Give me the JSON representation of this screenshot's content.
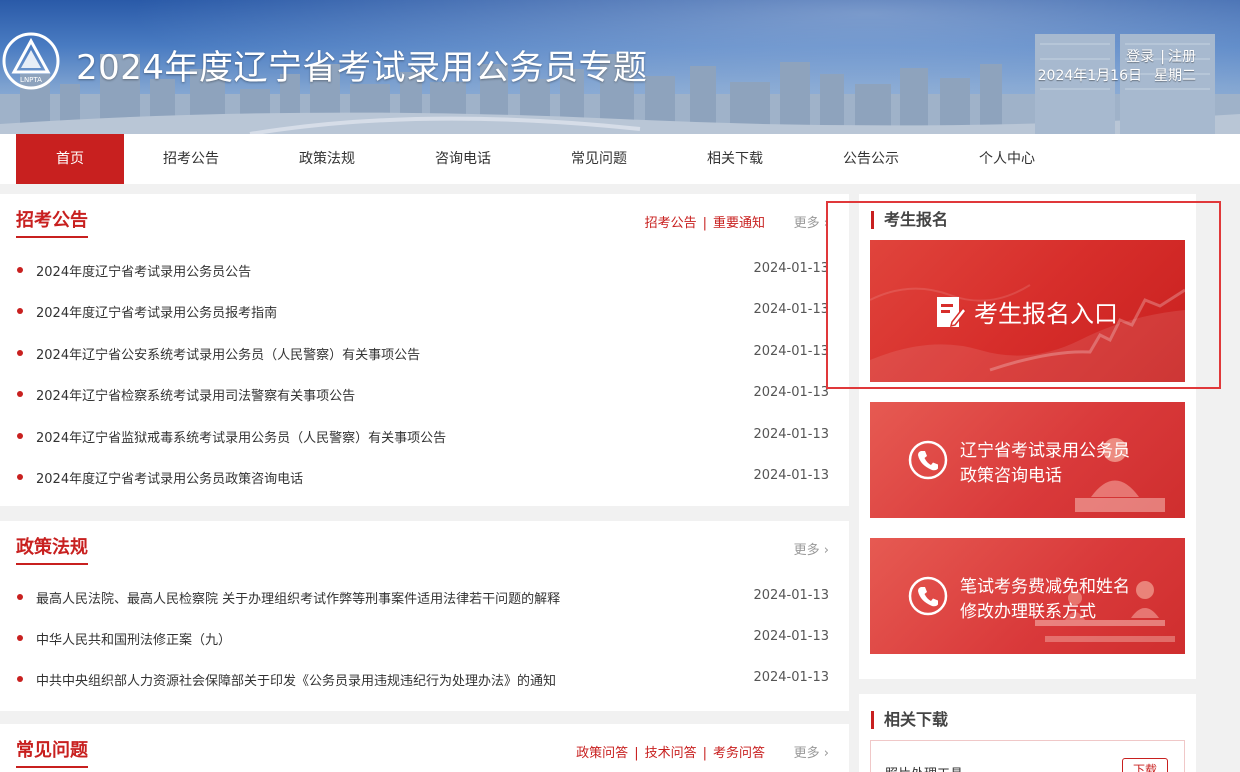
{
  "header": {
    "title": "2024年度辽宁省考试录用公务员专题",
    "logo_text": "LNPTA",
    "login": "登录",
    "register": "注册",
    "date": "2024年1月16日",
    "weekday": "星期二"
  },
  "nav": {
    "items": [
      {
        "label": "首页"
      },
      {
        "label": "招考公告"
      },
      {
        "label": "政策法规"
      },
      {
        "label": "咨询电话"
      },
      {
        "label": "常见问题"
      },
      {
        "label": "相关下载"
      },
      {
        "label": "公告公示"
      },
      {
        "label": "个人中心"
      }
    ]
  },
  "announcements": {
    "title": "招考公告",
    "links": [
      "招考公告",
      "重要通知"
    ],
    "more": "更多 ›",
    "items": [
      {
        "title": "2024年度辽宁省考试录用公务员公告",
        "date": "2024-01-13"
      },
      {
        "title": "2024年度辽宁省考试录用公务员报考指南",
        "date": "2024-01-13"
      },
      {
        "title": "2024年辽宁省公安系统考试录用公务员（人民警察）有关事项公告",
        "date": "2024-01-13"
      },
      {
        "title": "2024年辽宁省检察系统考试录用司法警察有关事项公告",
        "date": "2024-01-13"
      },
      {
        "title": "2024年辽宁省监狱戒毒系统考试录用公务员（人民警察）有关事项公告",
        "date": "2024-01-13"
      },
      {
        "title": "2024年度辽宁省考试录用公务员政策咨询电话",
        "date": "2024-01-13"
      }
    ]
  },
  "policies": {
    "title": "政策法规",
    "more": "更多 ›",
    "items": [
      {
        "title": "最高人民法院、最高人民检察院 关于办理组织考试作弊等刑事案件适用法律若干问题的解释",
        "date": "2024-01-13"
      },
      {
        "title": "中华人民共和国刑法修正案（九）",
        "date": "2024-01-13"
      },
      {
        "title": "中共中央组织部人力资源社会保障部关于印发《公务员录用违规违纪行为处理办法》的通知",
        "date": "2024-01-13"
      }
    ]
  },
  "faq": {
    "title": "常见问题",
    "links": [
      "政策问答",
      "技术问答",
      "考务问答"
    ],
    "more": "更多 ›"
  },
  "registration": {
    "title": "考生报名",
    "entry": "考生报名入口",
    "hotline_line1": "辽宁省考试录用公务员",
    "hotline_line2": "政策咨询电话",
    "fee_line1": "笔试考务费减免和姓名",
    "fee_line2": "修改办理联系方式"
  },
  "downloads": {
    "title": "相关下载",
    "first_item": "照片处理工具",
    "download_button": "下载"
  },
  "colors": {
    "primary_red": "#c8201f",
    "banner_blue": "#2a5aa8"
  }
}
